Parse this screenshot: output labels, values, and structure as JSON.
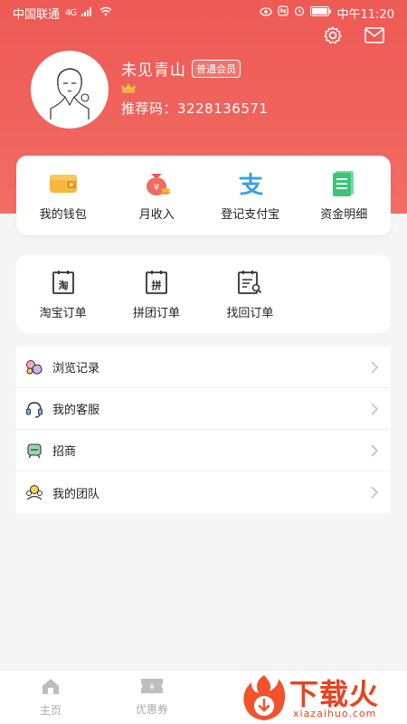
{
  "status_bar": {
    "carrier": "中国联通",
    "network": "4G",
    "time": "中午11:20"
  },
  "profile": {
    "username": "未见青山",
    "member_level": "普通会员",
    "referral_label": "推荐码：",
    "referral_code": "3228136571"
  },
  "quick_actions": [
    {
      "label": "我的钱包",
      "icon": "wallet-icon"
    },
    {
      "label": "月收入",
      "icon": "money-bag-icon"
    },
    {
      "label": "登记支付宝",
      "icon": "alipay-icon"
    },
    {
      "label": "资金明细",
      "icon": "ledger-icon"
    }
  ],
  "orders": [
    {
      "label": "淘宝订单",
      "icon": "taobao-order-icon"
    },
    {
      "label": "拼团订单",
      "icon": "group-order-icon"
    },
    {
      "label": "找回订单",
      "icon": "find-order-icon"
    }
  ],
  "menu": [
    {
      "label": "浏览记录",
      "icon": "history-icon"
    },
    {
      "label": "我的客服",
      "icon": "headset-icon"
    },
    {
      "label": "招商",
      "icon": "merchant-icon"
    },
    {
      "label": "我的团队",
      "icon": "team-icon"
    }
  ],
  "bottom_nav": [
    {
      "label": "主页",
      "icon": "home-icon"
    },
    {
      "label": "优惠券",
      "icon": "coupon-icon"
    }
  ],
  "watermark": {
    "title": "下载火",
    "subtitle": "xiazaihuo.com"
  },
  "colors": {
    "header": "#ee5a55",
    "accent_gold": "#f2b52c",
    "alipay_blue": "#3aa2e0",
    "ledger_green": "#3ec47a",
    "watermark": "#e8431f"
  }
}
